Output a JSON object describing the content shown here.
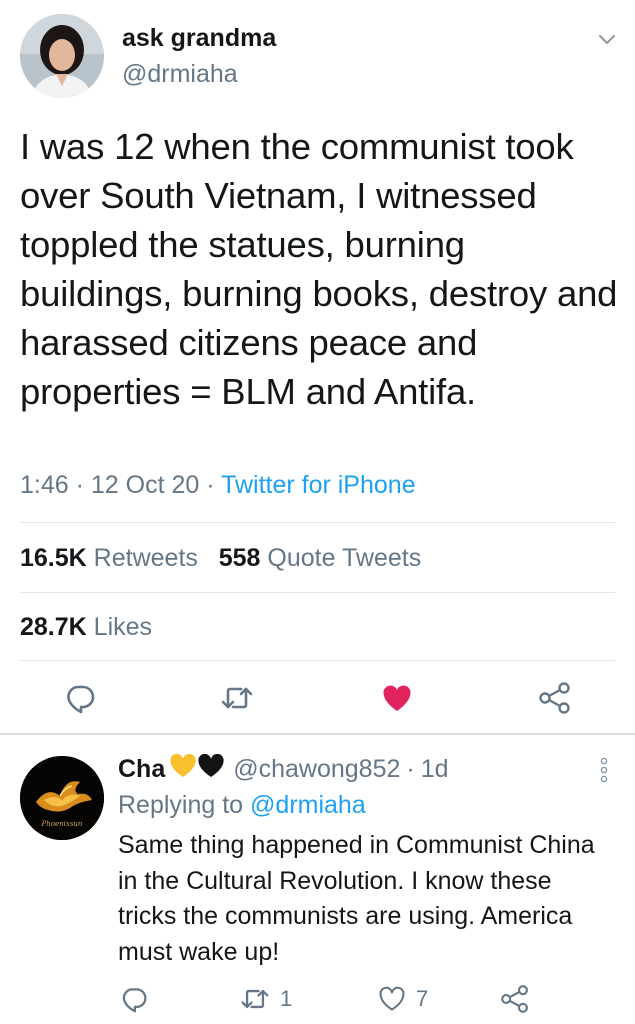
{
  "colors": {
    "text": "#14171a",
    "secondary": "#657786",
    "link": "#1da1f2",
    "like": "#e0245e",
    "divider": "#e1e8ed"
  },
  "tweet": {
    "author": {
      "name": "ask grandma",
      "handle": "@drmiaha"
    },
    "text": "I was 12 when the communist took over South Vietnam, I witnessed toppled the statues, burning buildings, burning books, destroy and harassed citizens peace and properties = BLM and Antifa.",
    "time": "1:46",
    "date": "12 Oct 20",
    "separator": " · ",
    "source": "Twitter for iPhone",
    "stats": {
      "retweets_count": "16.5K",
      "retweets_label": "Retweets",
      "quotes_count": "558",
      "quotes_label": "Quote Tweets",
      "likes_count": "28.7K",
      "likes_label": "Likes"
    },
    "liked": true,
    "icons": [
      "reply-icon",
      "retweet-icon",
      "like-icon",
      "share-icon",
      "chevron-down-icon"
    ]
  },
  "reply": {
    "author": {
      "name": "Cha",
      "handle": "@chawong852",
      "emoji": [
        "yellow-heart",
        "black-heart"
      ]
    },
    "age": "1d",
    "replying_prefix": "Replying to ",
    "replying_to": "@drmiaha",
    "text": "Same thing happened in Communist China in the Cultural Revolution. I know these tricks the communists are using. America must wake up!",
    "retweets": "1",
    "likes": "7",
    "avatar_text": "Phoenixsun"
  }
}
